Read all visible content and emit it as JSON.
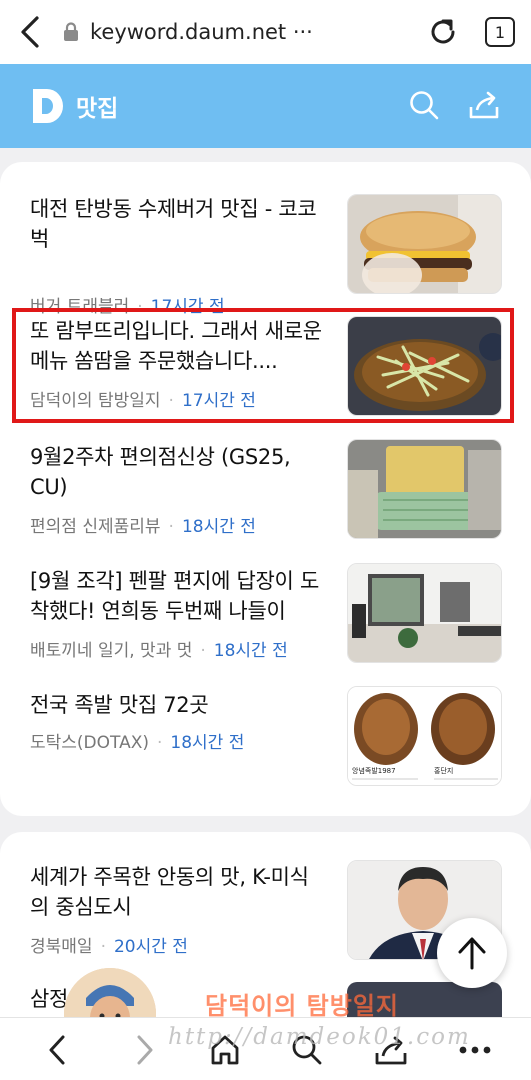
{
  "browser": {
    "url": "keyword.daum.net ···",
    "tab_count": "1"
  },
  "header": {
    "title": "맛집",
    "accent_color": "#6fbef2"
  },
  "articles": [
    {
      "title": "대전 탄방동 수제버거 맛집 - 코코벅",
      "source": "버거 트래블러",
      "time": "17시간 전"
    },
    {
      "title": "또 람부뜨리입니다. 그래서 새로운 메뉴 쏨땀을 주문했습니다....",
      "source": "담덕이의 탐방일지",
      "time": "17시간 전"
    },
    {
      "title": "9월2주차 편의점신상 (GS25, CU)",
      "source": "편의점 신제품리뷰",
      "time": "18시간 전"
    },
    {
      "title": "[9월 조각] 펜팔 편지에 답장이 도착했다! 연희동 두번째 나들이",
      "source": "배토끼네 일기, 맛과 멋",
      "time": "18시간 전"
    },
    {
      "title": "전국 족발 맛집 72곳",
      "source": "도탁스(DOTAX)",
      "time": "18시간 전"
    },
    {
      "title": "세계가 주목한 안동의 맛, K-미식의 중심도시",
      "source": "경북매일",
      "time": "20시간 전"
    },
    {
      "title": "삼정",
      "source": "",
      "time": ""
    }
  ],
  "thumbs": {
    "jokbal_label_1": "앙념족발1987",
    "jokbal_label_2": "홍단지"
  },
  "watermark": {
    "name": "담덕이의 탐방일지",
    "url": "http://damdeok01.com"
  }
}
